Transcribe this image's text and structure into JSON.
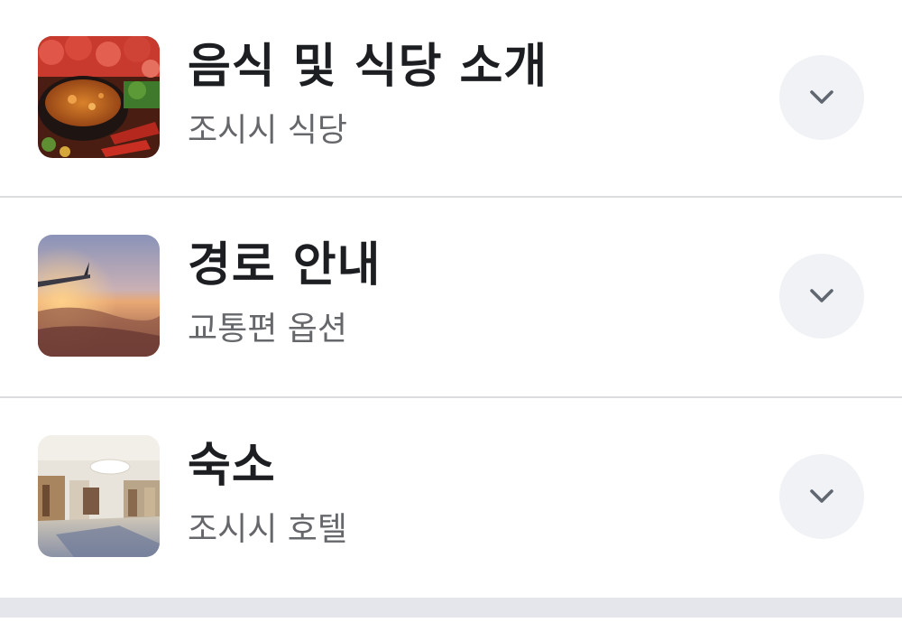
{
  "items": [
    {
      "title": "음식 및 식당 소개",
      "subtitle": "조시시 식당",
      "thumbnail": "food-photo",
      "icon": "chevron-down-icon"
    },
    {
      "title": "경로 안내",
      "subtitle": "교통편 옵션",
      "thumbnail": "airplane-sunset-photo",
      "icon": "chevron-down-icon"
    },
    {
      "title": "숙소",
      "subtitle": "조시시 호텔",
      "thumbnail": "hotel-lobby-photo",
      "icon": "chevron-down-icon"
    }
  ],
  "colors": {
    "title": "#1c1e21",
    "subtitle": "#65676b",
    "button_bg": "#f0f2f5",
    "chevron": "#606770",
    "divider": "#dcdde0",
    "bottom_bar": "#e4e6eb"
  }
}
